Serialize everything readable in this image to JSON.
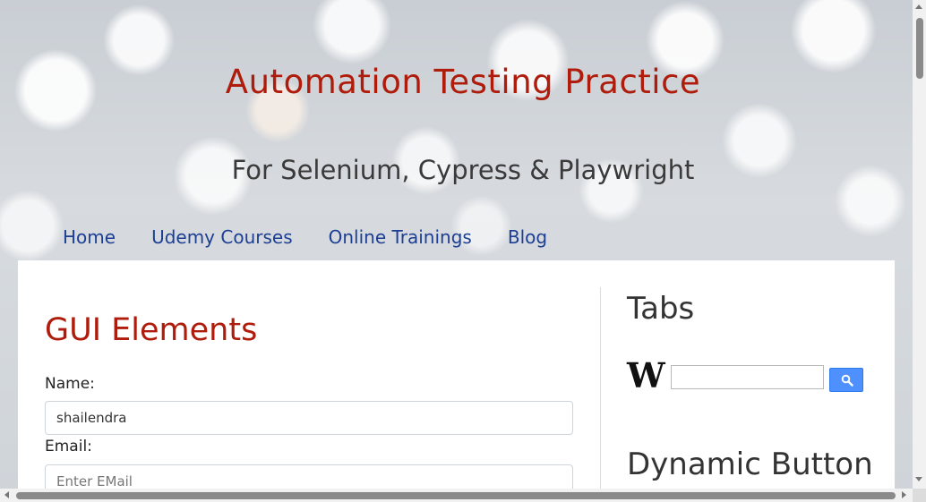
{
  "header": {
    "title": "Automation Testing Practice",
    "subtitle": "For Selenium, Cypress & Playwright"
  },
  "nav": {
    "items": [
      {
        "label": "Home"
      },
      {
        "label": "Udemy Courses"
      },
      {
        "label": "Online Trainings"
      },
      {
        "label": "Blog"
      }
    ]
  },
  "main": {
    "section_title": "GUI Elements",
    "name_label": "Name:",
    "name_value": "shailendra",
    "email_label": "Email:",
    "email_placeholder": "Enter EMail"
  },
  "sidebar": {
    "tabs_title": "Tabs",
    "wikipedia_logo": "W",
    "wiki_search_value": "",
    "dynamic_button_title": "Dynamic Button"
  },
  "colors": {
    "title_red": "#b01c0c",
    "nav_blue": "#1c3f94",
    "search_button_blue": "#4d90fe"
  },
  "icons": {
    "wiki_logo": "wikipedia-icon",
    "search": "search-icon"
  }
}
